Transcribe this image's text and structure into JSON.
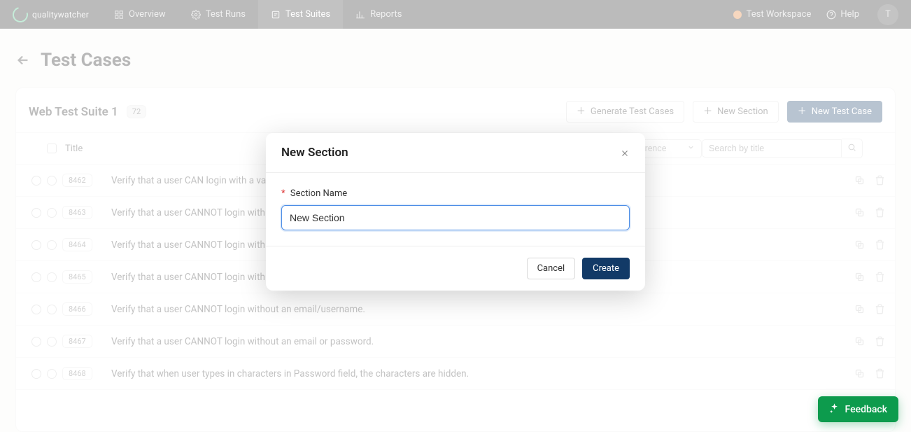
{
  "brand": {
    "name": "qualitywatcher"
  },
  "nav": {
    "items": [
      {
        "label": "Overview",
        "icon": "dashboard-icon",
        "active": false
      },
      {
        "label": "Test Runs",
        "icon": "gear-icon",
        "active": false
      },
      {
        "label": "Test Suites",
        "icon": "suite-icon",
        "active": true
      },
      {
        "label": "Reports",
        "icon": "chart-icon",
        "active": false
      }
    ],
    "workspace": "Test Workspace",
    "help": "Help",
    "avatar_initial": "T"
  },
  "page": {
    "title": "Test Cases"
  },
  "suite": {
    "name": "Web Test Suite 1",
    "count": "72",
    "buttons": {
      "generate": "Generate Test Cases",
      "new_section": "New Section",
      "new_case": "New Test Case"
    }
  },
  "table": {
    "header": {
      "title": "Title",
      "filter_placeholder": "Filter by reference",
      "search_placeholder": "Search by title"
    },
    "rows": [
      {
        "id": "8462",
        "title": "Verify that a user CAN login with a valid email and password combination."
      },
      {
        "id": "8463",
        "title": "Verify that a user CANNOT login with a valid email and an invalid password."
      },
      {
        "id": "8464",
        "title": "Verify that a user CANNOT login with a valid email and an old password."
      },
      {
        "id": "8465",
        "title": "Verify that a user CANNOT login with an invalid email and password."
      },
      {
        "id": "8466",
        "title": "Verify that a user CANNOT login without an email/username."
      },
      {
        "id": "8467",
        "title": "Verify that a user CANNOT login without an email or password."
      },
      {
        "id": "8468",
        "title": "Verify that when user types in characters in Password field, the characters are hidden."
      }
    ]
  },
  "modal": {
    "title": "New Section",
    "field_label": "Section Name",
    "field_value": "New Section",
    "cancel": "Cancel",
    "create": "Create"
  },
  "feedback": {
    "label": "Feedback"
  }
}
